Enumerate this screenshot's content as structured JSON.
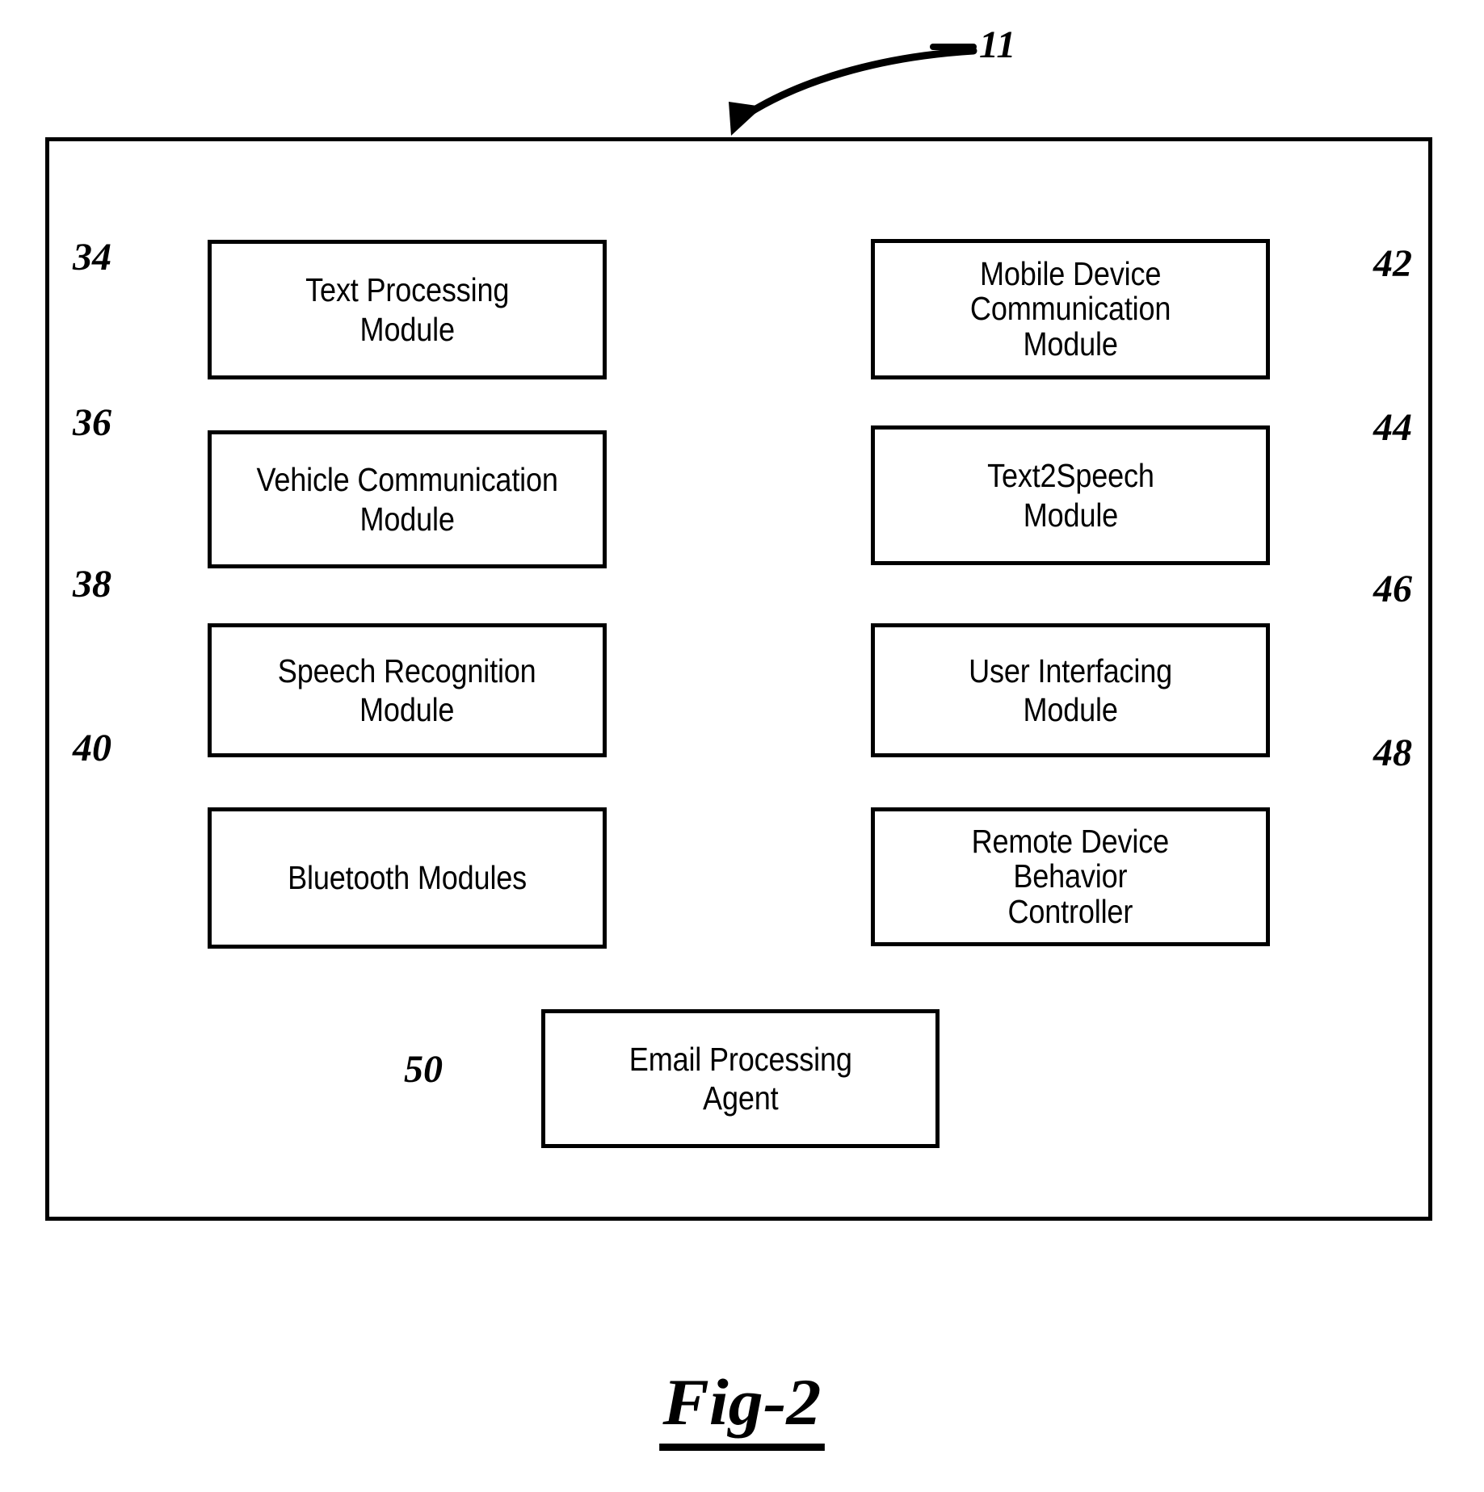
{
  "figure": {
    "caption": "Fig-2",
    "system_ref": "11"
  },
  "system": {
    "modules": [
      {
        "ref": "34",
        "label": "Text Processing\nModule",
        "column": "left",
        "lines": 2
      },
      {
        "ref": "36",
        "label": "Vehicle Communication\nModule",
        "column": "left",
        "lines": 2
      },
      {
        "ref": "38",
        "label": "Speech Recognition\nModule",
        "column": "left",
        "lines": 2
      },
      {
        "ref": "40",
        "label": "Bluetooth Modules",
        "column": "left",
        "lines": 1
      },
      {
        "ref": "42",
        "label": "Mobile Device\nCommunication\nModule",
        "column": "right",
        "lines": 3
      },
      {
        "ref": "44",
        "label": "Text2Speech\nModule",
        "column": "right",
        "lines": 2
      },
      {
        "ref": "46",
        "label": "User Interfacing\nModule",
        "column": "right",
        "lines": 2
      },
      {
        "ref": "48",
        "label": "Remote Device\nBehavior\nController",
        "column": "right",
        "lines": 3
      },
      {
        "ref": "50",
        "label": "Email Processing\nAgent",
        "column": "bottom",
        "lines": 2
      }
    ]
  },
  "colors": {
    "stroke": "#000000",
    "fill": "#ffffff"
  }
}
